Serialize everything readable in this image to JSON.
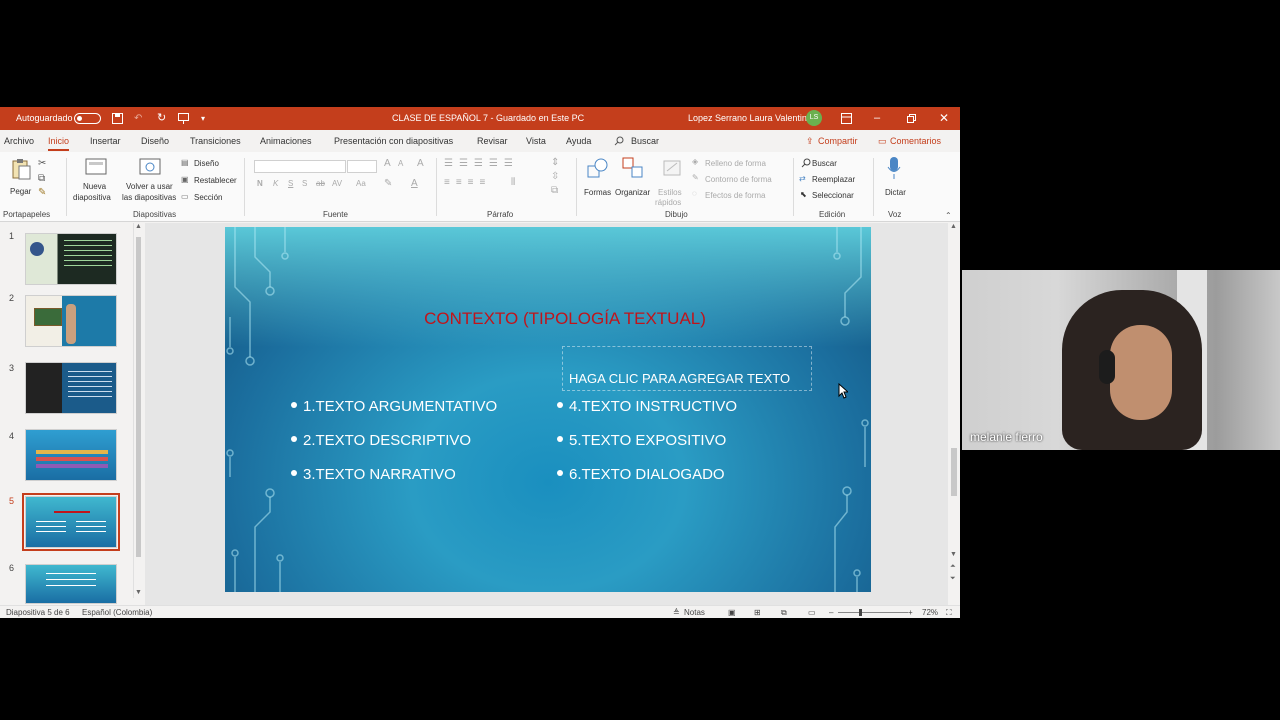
{
  "titlebar": {
    "autosave_label": "Autoguardado",
    "doc_title": "CLASE DE ESPAÑOL 7  -  Guardado en Este PC",
    "user_name": "Lopez Serrano Laura Valentina",
    "user_initials": "LS"
  },
  "tabs": [
    "Archivo",
    "Inicio",
    "Insertar",
    "Diseño",
    "Transiciones",
    "Animaciones",
    "Presentación con diapositivas",
    "Revisar",
    "Vista",
    "Ayuda"
  ],
  "search_label": "Buscar",
  "share_label": "Compartir",
  "comments_label": "Comentarios",
  "ribbon": {
    "pegar": "Pegar",
    "portapapeles": "Portapapeles",
    "nueva_diapositiva_1": "Nueva",
    "nueva_diapositiva_2": "diapositiva",
    "volver_1": "Volver a usar",
    "volver_2": "las diapositivas",
    "diseno": "Diseño",
    "restablecer": "Restablecer",
    "seccion": "Sección",
    "diapositivas": "Diapositivas",
    "fuente": "Fuente",
    "font_buttons": [
      "N",
      "K",
      "S",
      "S",
      "ab",
      "AV",
      "Aa"
    ],
    "parrafo": "Párrafo",
    "formas": "Formas",
    "organizar": "Organizar",
    "estilos_1": "Estilos",
    "estilos_2": "rápidos",
    "relleno": "Relleno de forma",
    "contorno": "Contorno de forma",
    "efectos": "Efectos de forma",
    "dibujo": "Dibujo",
    "buscar": "Buscar",
    "reemplazar": "Reemplazar",
    "seleccionar": "Seleccionar",
    "edicion": "Edición",
    "dictar": "Dictar",
    "voz": "Voz"
  },
  "thumbnails": [
    "1",
    "2",
    "3",
    "4",
    "5",
    "6"
  ],
  "selected_slide": 5,
  "slide": {
    "title": "CONTEXTO (TIPOLOGÍA TEXTUAL)",
    "placeholder": "HAGA CLIC PARA AGREGAR TEXTO",
    "left_items": [
      "1.TEXTO ARGUMENTATIVO",
      "2.TEXTO DESCRIPTIVO",
      "3.TEXTO NARRATIVO"
    ],
    "right_items": [
      "4.TEXTO INSTRUCTIVO",
      "5.TEXTO EXPOSITIVO",
      "6.TEXTO DIALOGADO"
    ]
  },
  "status": {
    "slide_info": "Diapositiva 5 de 6",
    "language": "Español (Colombia)",
    "notas": "Notas",
    "zoom": "72%"
  },
  "video": {
    "participant_name": "melanie fierro"
  },
  "colors": {
    "accent": "#c43e1c",
    "slide_title": "#c0141b"
  }
}
